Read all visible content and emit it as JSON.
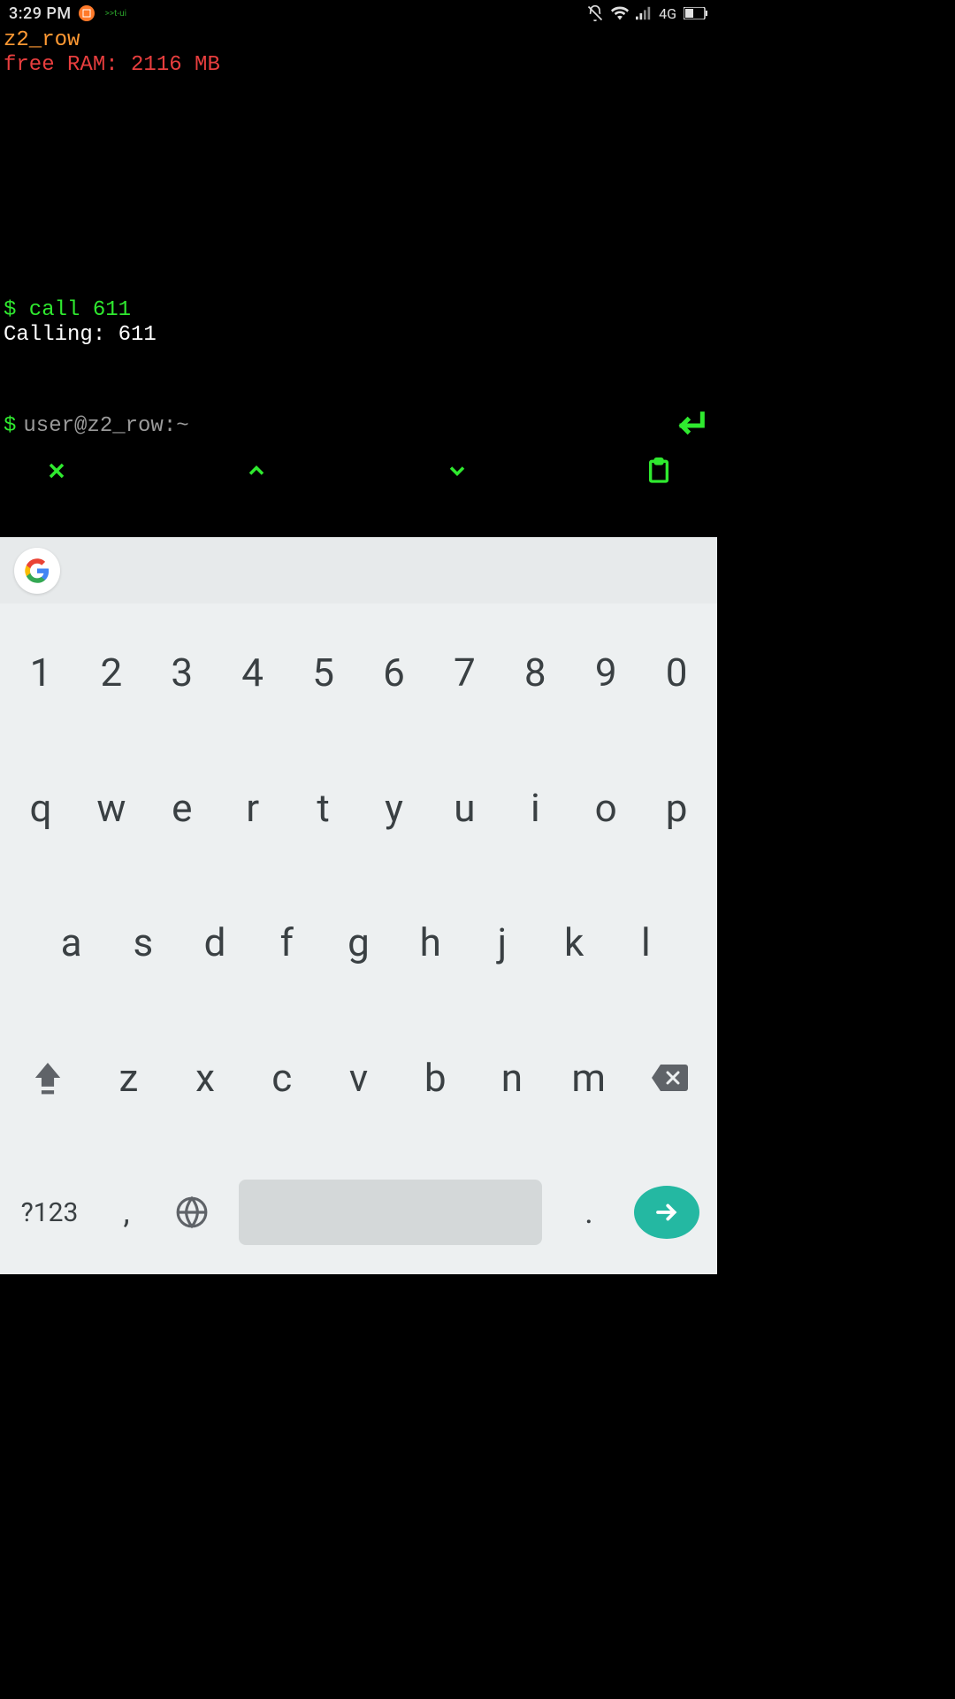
{
  "status": {
    "time": "3:29 PM",
    "app_label": ">>t-ui",
    "network_label": "4G"
  },
  "terminal": {
    "host_line": "z2_row",
    "ram_line": "free RAM: 2116 MB",
    "command_line": "$ call 611",
    "output_line": "Calling: 611",
    "prompt_symbol": "$",
    "prompt_text": "user@z2_row:~"
  },
  "keyboard": {
    "row_num": [
      "1",
      "2",
      "3",
      "4",
      "5",
      "6",
      "7",
      "8",
      "9",
      "0"
    ],
    "row_top": [
      "q",
      "w",
      "e",
      "r",
      "t",
      "y",
      "u",
      "i",
      "o",
      "p"
    ],
    "row_mid": [
      "a",
      "s",
      "d",
      "f",
      "g",
      "h",
      "j",
      "k",
      "l"
    ],
    "row_bot": [
      "z",
      "x",
      "c",
      "v",
      "b",
      "n",
      "m"
    ],
    "sym_label": "?123",
    "comma": ",",
    "period": "."
  }
}
